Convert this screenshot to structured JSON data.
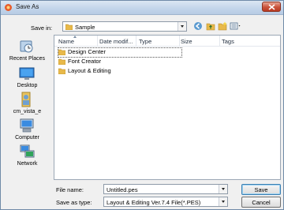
{
  "window": {
    "title": "Save As"
  },
  "savein": {
    "label": "Save in:",
    "value": "Sample"
  },
  "places": [
    {
      "label": "Recent Places",
      "icon": "recent-places-icon"
    },
    {
      "label": "Desktop",
      "icon": "desktop-icon"
    },
    {
      "label": "cm_vista_e",
      "icon": "user-folder-icon"
    },
    {
      "label": "Computer",
      "icon": "computer-icon"
    },
    {
      "label": "Network",
      "icon": "network-icon"
    }
  ],
  "columns": [
    "Name",
    "Date modif...",
    "Type",
    "Size",
    "Tags"
  ],
  "files": [
    {
      "name": "Design Center"
    },
    {
      "name": "Font Creator"
    },
    {
      "name": "Layout & Editing"
    }
  ],
  "filename": {
    "label": "File name:",
    "value": "Untitled.pes"
  },
  "filetype": {
    "label": "Save as type:",
    "value": "Layout & Editing Ver.7.4 File(*.PES)"
  },
  "buttons": {
    "save": "Save",
    "cancel": "Cancel"
  },
  "colors": {
    "folder": "#e8b94a",
    "accent": "#3c7fb1",
    "close": "#c9523a"
  }
}
